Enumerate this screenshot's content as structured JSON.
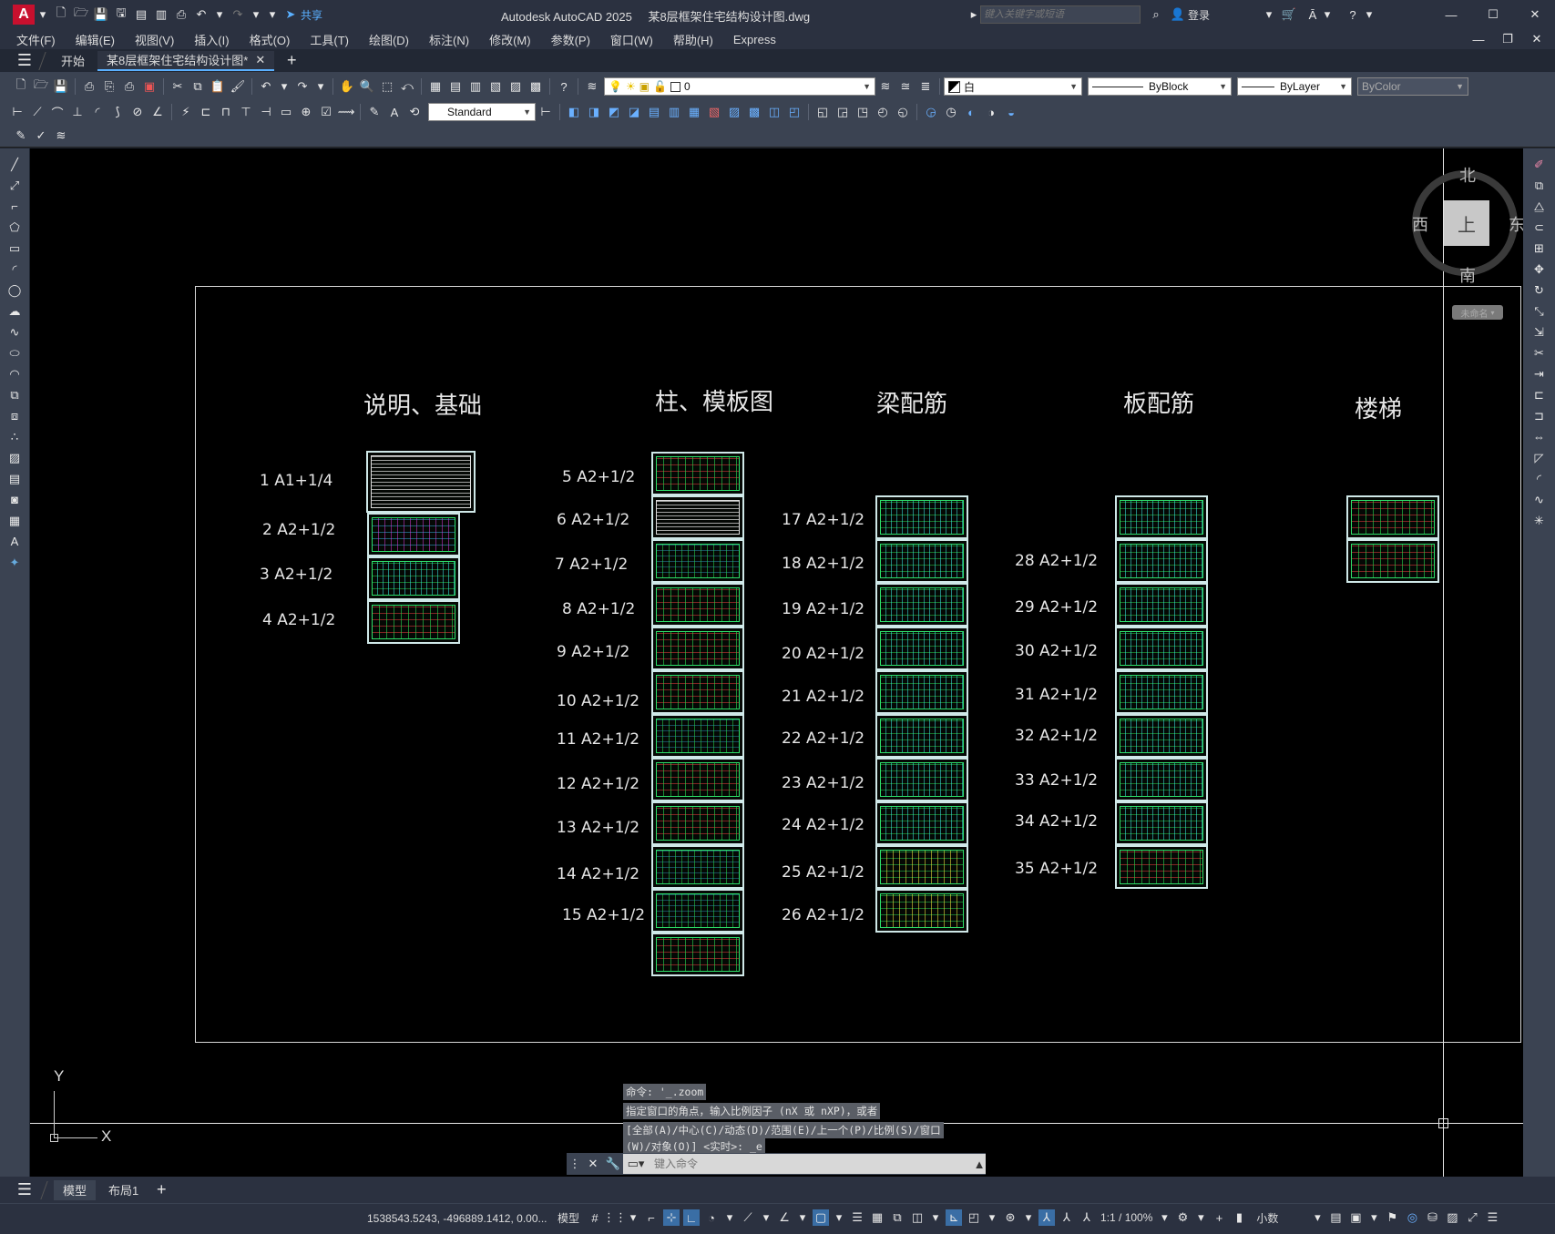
{
  "app": {
    "title": "Autodesk AutoCAD 2025",
    "file": "某8层框架住宅结构设计图.dwg",
    "share_label": "共享",
    "search_placeholder": "键入关键字或短语",
    "login_label": "登录"
  },
  "menu": [
    "文件(F)",
    "编辑(E)",
    "视图(V)",
    "插入(I)",
    "格式(O)",
    "工具(T)",
    "绘图(D)",
    "标注(N)",
    "修改(M)",
    "参数(P)",
    "窗口(W)",
    "帮助(H)",
    "Express"
  ],
  "tabs": {
    "start": "开始",
    "doc": "某8层框架住宅结构设计图*"
  },
  "props": {
    "layer": "0",
    "color": "白",
    "linetype": "ByBlock",
    "lineweight": "ByLayer",
    "plotstyle": "ByColor",
    "textstyle": "Standard"
  },
  "viewcube": {
    "north": "北",
    "south": "南",
    "east": "东",
    "west": "西",
    "top": "上",
    "wcs": "未命名"
  },
  "drawing": {
    "headings": [
      "说明、基础",
      "柱、模板图",
      "梁配筋",
      "板配筋",
      "楼梯"
    ],
    "labels": [
      "1  A1+1/4",
      "2  A2+1/2",
      "3  A2+1/2",
      "4  A2+1/2",
      "5  A2+1/2",
      "6  A2+1/2",
      "7  A2+1/2",
      "8  A2+1/2",
      "9  A2+1/2",
      "10  A2+1/2",
      "11  A2+1/2",
      "12  A2+1/2",
      "13  A2+1/2",
      "14  A2+1/2",
      "15  A2+1/2",
      "17  A2+1/2",
      "18  A2+1/2",
      "19  A2+1/2",
      "20  A2+1/2",
      "21  A2+1/2",
      "22  A2+1/2",
      "23  A2+1/2",
      "24  A2+1/2",
      "25  A2+1/2",
      "26  A2+1/2",
      "28  A2+1/2",
      "29  A2+1/2",
      "30  A2+1/2",
      "31  A2+1/2",
      "32  A2+1/2",
      "33  A2+1/2",
      "34  A2+1/2",
      "35  A2+1/2"
    ]
  },
  "ucs": {
    "x": "X",
    "y": "Y"
  },
  "command": {
    "history": [
      "命令: '_.zoom",
      "指定窗口的角点，输入比例因子 (nX 或 nXP)，或者",
      "[全部(A)/中心(C)/动态(D)/范围(E)/上一个(P)/比例(S)/窗口",
      "(W)/对象(O)] <实时>: _e"
    ],
    "placeholder": "键入命令"
  },
  "layout_tabs": [
    "模型",
    "布局1"
  ],
  "status": {
    "coords": "1538543.5243, -496889.1412, 0.00...",
    "model": "模型",
    "scale": "1:1 / 100%",
    "units": "小数"
  }
}
